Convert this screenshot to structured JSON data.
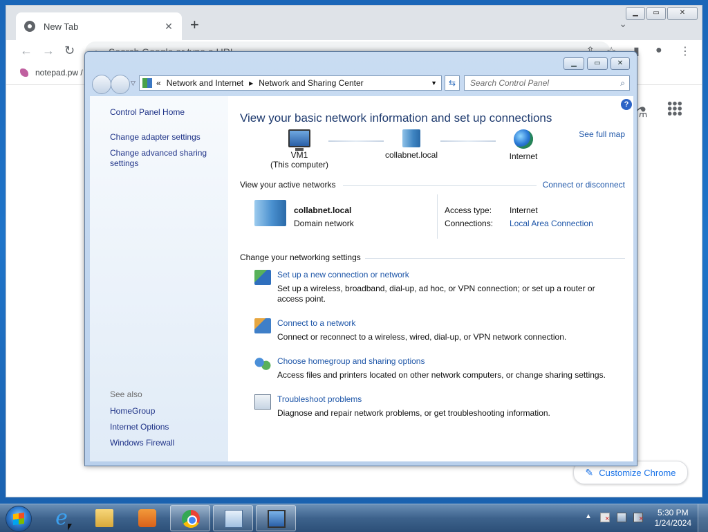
{
  "chrome": {
    "tab_title": "New Tab",
    "tab_close": "✕",
    "new_tab": "+",
    "omnibox_placeholder": "Search Google or type a URL",
    "bookmark": "notepad.pw /",
    "customize_label": "Customize Chrome"
  },
  "control_panel": {
    "breadcrumb": [
      "«",
      "Network and Internet",
      "Network and Sharing Center"
    ],
    "search_placeholder": "Search Control Panel",
    "left": {
      "home": "Control Panel Home",
      "links": [
        "Change adapter settings",
        "Change advanced sharing settings"
      ],
      "see_also_label": "See also",
      "see_also": [
        "HomeGroup",
        "Internet Options",
        "Windows Firewall"
      ]
    },
    "main": {
      "title": "View your basic network information and set up connections",
      "see_full_map": "See full map",
      "map": [
        {
          "name": "VM1",
          "sub": "(This computer)"
        },
        {
          "name": "collabnet.local",
          "sub": ""
        },
        {
          "name": "Internet",
          "sub": ""
        }
      ],
      "active_networks_label": "View your active networks",
      "connect_or_disconnect": "Connect or disconnect",
      "network": {
        "name": "collabnet.local",
        "type": "Domain network",
        "access_type_label": "Access type:",
        "access_type_value": "Internet",
        "connections_label": "Connections:",
        "connections_value": "Local Area Connection"
      },
      "change_settings_label": "Change your networking settings",
      "tasks": [
        {
          "title": "Set up a new connection or network",
          "desc": "Set up a wireless, broadband, dial-up, ad hoc, or VPN connection; or set up a router or access point."
        },
        {
          "title": "Connect to a network",
          "desc": "Connect or reconnect to a wireless, wired, dial-up, or VPN network connection."
        },
        {
          "title": "Choose homegroup and sharing options",
          "desc": "Access files and printers located on other network computers, or change sharing settings."
        },
        {
          "title": "Troubleshoot problems",
          "desc": "Diagnose and repair network problems, or get troubleshooting information."
        }
      ]
    }
  },
  "taskbar": {
    "time": "5:30 PM",
    "date": "1/24/2024",
    "tray_arrow": "▲"
  }
}
